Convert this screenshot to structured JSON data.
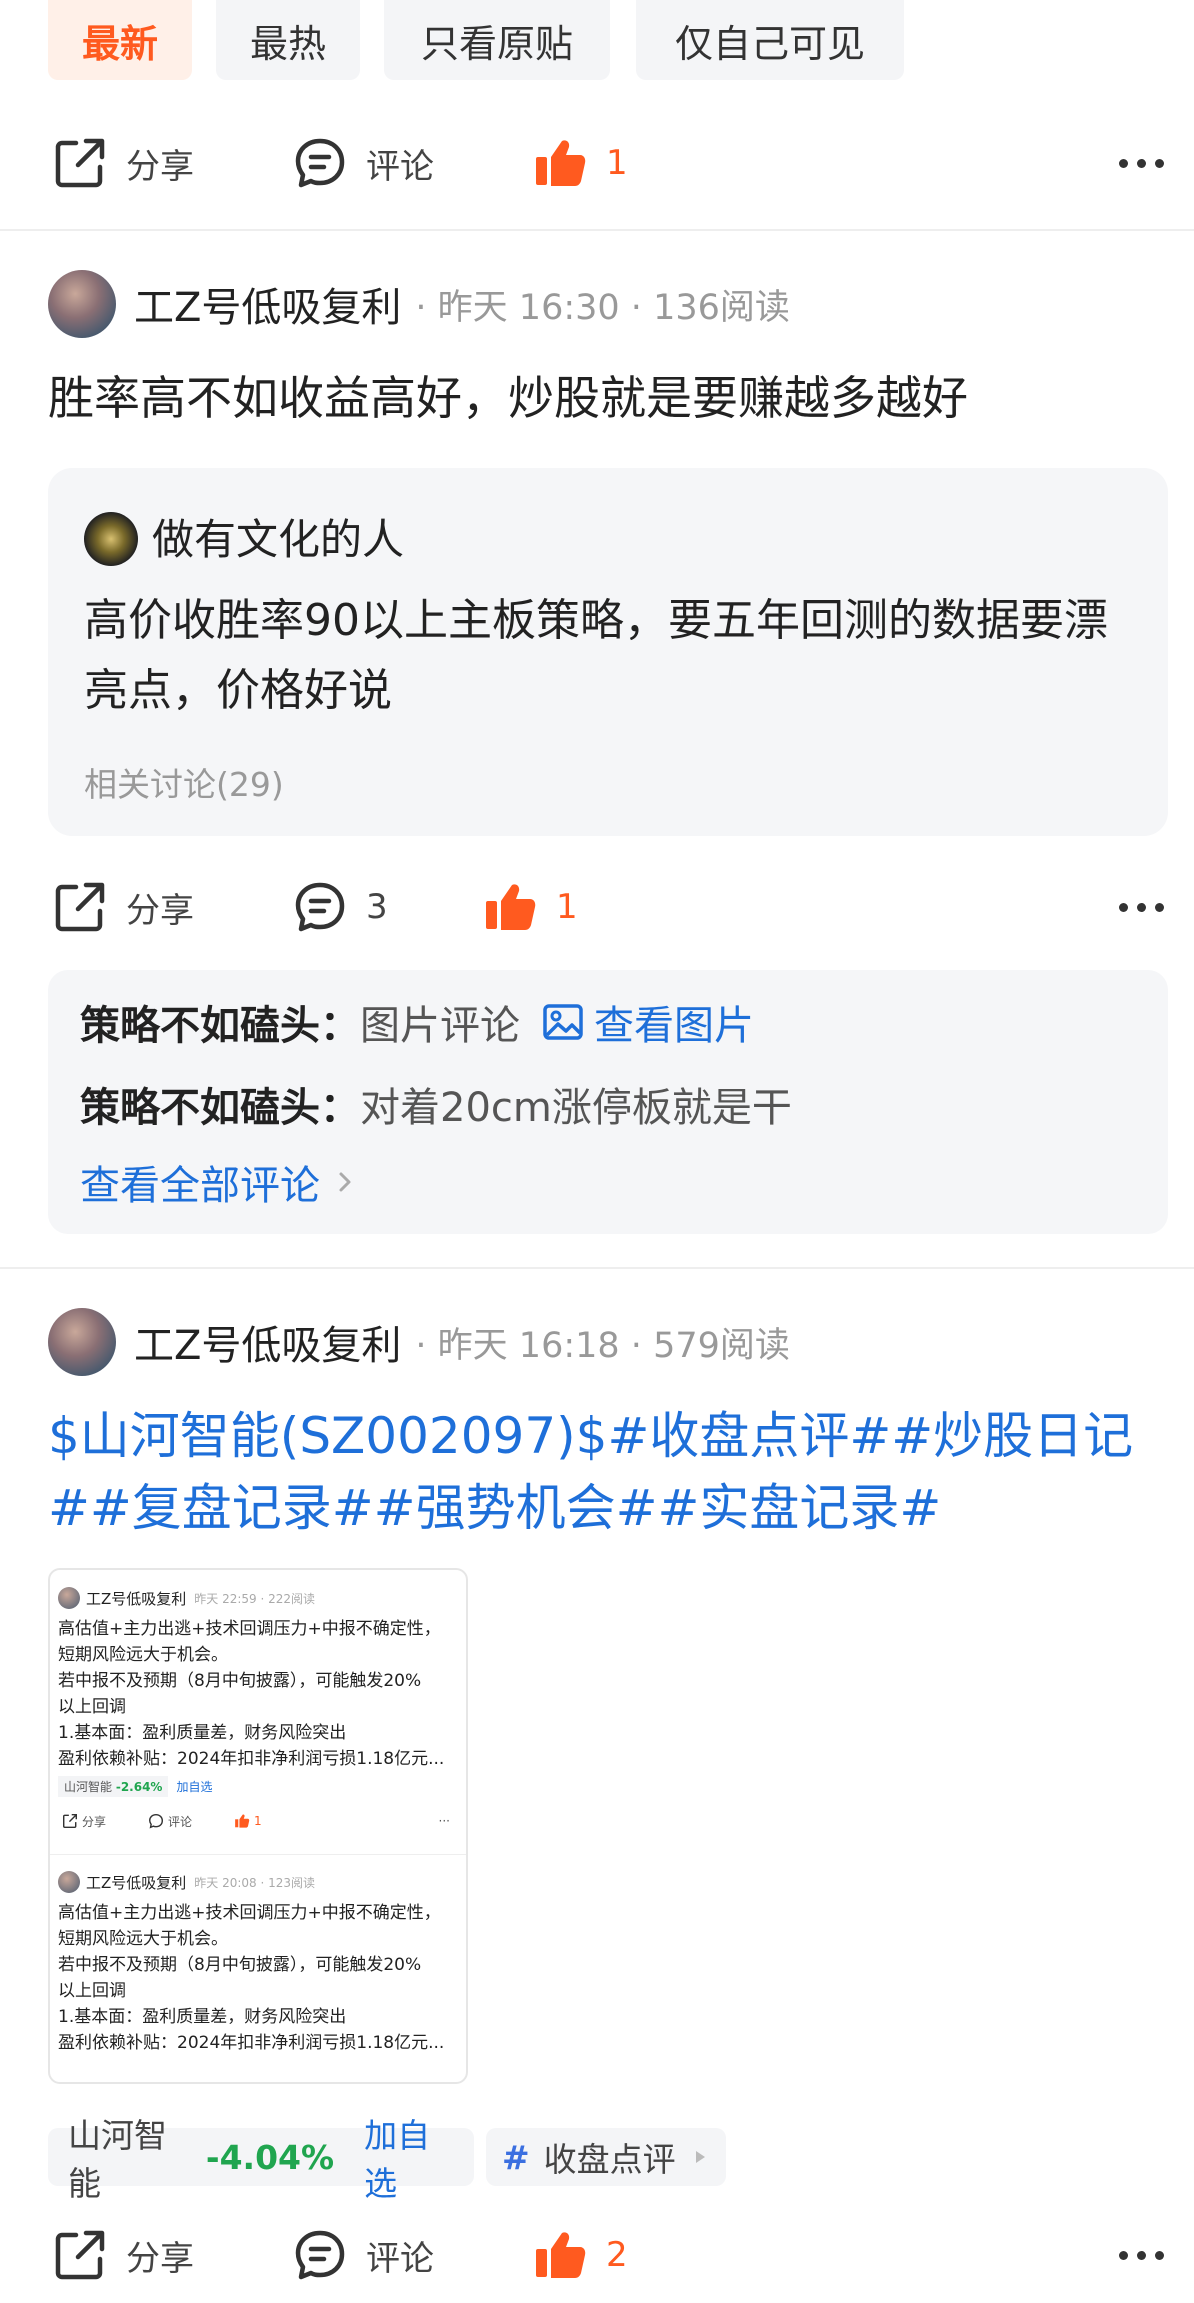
{
  "filter_tabs": [
    {
      "label": "最新",
      "active": true
    },
    {
      "label": "最热",
      "active": false
    },
    {
      "label": "只看原贴",
      "active": false
    },
    {
      "label": "仅自己可见",
      "active": false
    }
  ],
  "actions_top": {
    "share": "分享",
    "comment": "评论",
    "likes": "1"
  },
  "post1": {
    "author": "工Z号低吸复利",
    "time": "昨天 16:30",
    "reads": "136阅读",
    "text": "胜率高不如收益高好，炒股就是要赚越多越好",
    "quote": {
      "author": "做有文化的人",
      "text": "高价收胜率90以上主板策略，要五年回测的数据要漂亮点，价格好说",
      "related": "相关讨论(29)"
    },
    "actions": {
      "share": "分享",
      "comments": "3",
      "likes": "1"
    },
    "comments": [
      {
        "user": "策略不如磕头：",
        "text": "图片评论",
        "link": "查看图片"
      },
      {
        "user": "策略不如磕头：",
        "text": "对着20cm涨停板就是干"
      }
    ],
    "view_all": "查看全部评论"
  },
  "post2": {
    "author": "工Z号低吸复利",
    "time": "昨天 16:18",
    "reads": "579阅读",
    "title": "$山河智能(SZ002097)$#收盘点评##炒股日记##复盘记录##强势机会##实盘记录#",
    "image": {
      "items": [
        {
          "author": "工Z号低吸复利",
          "meta": "昨天 22:59 · 222阅读",
          "lines": [
            "高估值+主力出逃+技术回调压力+中报不确定性，",
            "短期风险远大于机会。",
            "若中报不及预期（8月中旬披露），可能触发20%",
            "以上回调",
            "1.基本面：盈利质量差，财务风险突出",
            "盈利依赖补贴：2024年扣非净利润亏损1.18亿元..."
          ],
          "stock": "山河智能",
          "change": "-2.64%",
          "add": "加自选",
          "share": "分享",
          "comment": "评论",
          "likes": "1"
        },
        {
          "author": "工Z号低吸复利",
          "meta": "昨天 20:08 · 123阅读",
          "lines": [
            "高估值+主力出逃+技术回调压力+中报不确定性，",
            "短期风险远大于机会。",
            "若中报不及预期（8月中旬披露），可能触发20%",
            "以上回调",
            "1.基本面：盈利质量差，财务风险突出",
            "盈利依赖补贴：2024年扣非净利润亏损1.18亿元..."
          ]
        }
      ]
    },
    "stock_tag": {
      "name": "山河智能",
      "change": "-4.04%",
      "add": "加自选"
    },
    "topic_tag": {
      "hash": "#",
      "label": "收盘点评"
    },
    "actions": {
      "share": "分享",
      "comment": "评论",
      "likes": "2"
    }
  },
  "colors": {
    "accent": "#ff5a1f",
    "link": "#1e6fd9",
    "down_green": "#20a54f"
  }
}
